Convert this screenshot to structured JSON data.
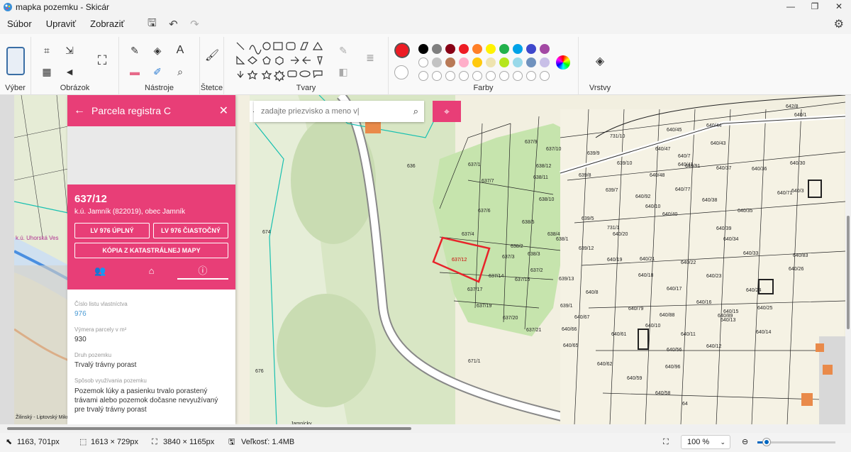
{
  "window": {
    "title": "mapka pozemku - Skicár",
    "controls": [
      "—",
      "❐",
      "✕"
    ]
  },
  "menu": {
    "items": [
      "Súbor",
      "Upraviť",
      "Zobraziť"
    ]
  },
  "ribbon": {
    "groups": {
      "select": "Výber",
      "image": "Obrázok",
      "tools": "Nástroje",
      "brushes": "Štetce",
      "shapes": "Tvary",
      "colors": "Farby",
      "layers": "Vrstvy"
    },
    "colors_top": [
      "#000000",
      "#7f7f7f",
      "#880015",
      "#ed1c24",
      "#ff7f27",
      "#fff200",
      "#22b14c",
      "#00a2e8",
      "#3f48cc",
      "#a349a4"
    ],
    "colors_bottom": [
      "#ffffff",
      "#c3c3c3",
      "#b97a57",
      "#ffaec9",
      "#ffc90e",
      "#efe4b0",
      "#b5e61d",
      "#99d9ea",
      "#7092be",
      "#c8bfe7"
    ],
    "primary_color": "#ed1c24",
    "secondary_color": "#ffffff"
  },
  "panel": {
    "title": "Parcela registra C",
    "parcel_number": "637/12",
    "location": "k.ú. Jamník (822019), obec Jamník",
    "buttons": {
      "lv_full": "LV 976 ÚPLNÝ",
      "lv_partial": "LV 976 ČIASTOČNÝ",
      "map_copy": "KÓPIA Z KATASTRÁLNEJ MAPY"
    },
    "fields": [
      {
        "label": "Číslo listu vlastníctva",
        "value": "976"
      },
      {
        "label": "Výmera parcely v m²",
        "value": "930"
      },
      {
        "label": "Druh pozemku",
        "value": "Trvalý trávny porast"
      },
      {
        "label": "Spôsob využívania pozemku",
        "value": "Pozemok lúky a pasienku trvalo porastený trávami alebo pozemok dočasne nevyužívaný pre trvalý trávny porast"
      }
    ]
  },
  "search": {
    "placeholder": "zadajte priezvisko a meno v|"
  },
  "map": {
    "labels": [
      "637/1",
      "637/7",
      "637/6",
      "637/4",
      "637/12",
      "637/3",
      "637/14",
      "637/17",
      "637/19",
      "637/20",
      "637/15",
      "637/2",
      "637/21",
      "637/9",
      "637/10",
      "638/12",
      "638/11",
      "638/10",
      "638/5",
      "638/4",
      "638/2",
      "638/3",
      "638/1",
      "639/9",
      "639/8",
      "639/7",
      "639/10",
      "639/5",
      "639/12",
      "639/13",
      "639/1",
      "640/20",
      "640/19",
      "640/18",
      "640/17",
      "640/16",
      "640/15",
      "640/14",
      "640/13",
      "640/12",
      "640/11",
      "640/10",
      "640/8",
      "640/67",
      "640/61",
      "640/62",
      "640/59",
      "640/58",
      "640/56",
      "640/96",
      "640/79",
      "640/88",
      "640/89",
      "640/24",
      "640/25",
      "640/23",
      "640/22",
      "640/21",
      "640/36",
      "640/35",
      "640/34",
      "640/33",
      "640/37",
      "640/38",
      "640/39",
      "640/40",
      "640/47",
      "640/48",
      "640/45",
      "640/44",
      "640/43",
      "640/30",
      "640/83",
      "640/26",
      "640/71",
      "640/65",
      "640/66",
      "640/92",
      "640/10",
      "640/41",
      "640/77",
      "640/91",
      "640/7",
      "640/3",
      "640/1",
      "642/8",
      "731/10",
      "731/1",
      "636",
      "674",
      "671/1",
      "676",
      "64",
      "Jamnícky",
      "k.ú. Uhorská Ves",
      "Žilinský - Liptovský Mikuláš"
    ]
  },
  "status": {
    "cursor": "1163, 701px",
    "selection": "1613 × 729px",
    "canvas_size": "3840 × 1165px",
    "file_size": "Veľkosť: 1.4MB",
    "zoom": "100 %",
    "zoom_fraction": 0.12
  }
}
